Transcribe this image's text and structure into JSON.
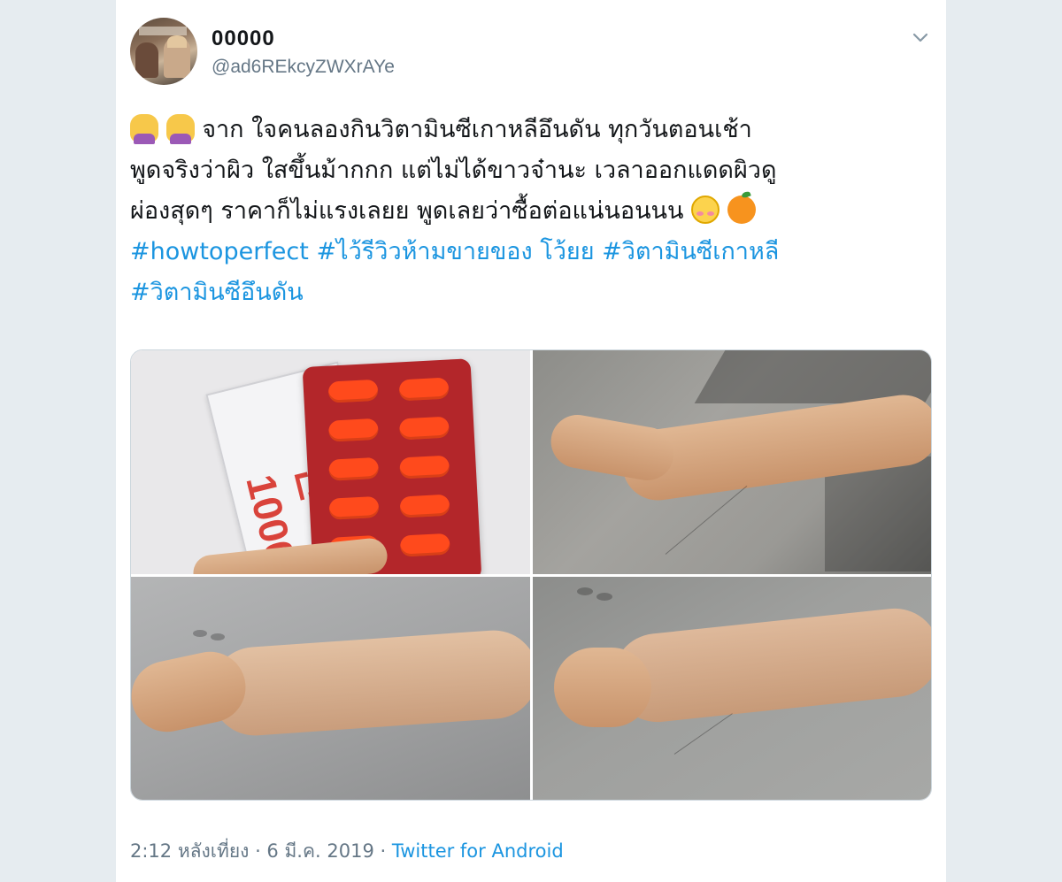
{
  "author": {
    "display_name": "00000",
    "handle": "@ad6REkcyZWXrAYe"
  },
  "tweet": {
    "lines": [
      "จาก ใจคนลองกินวิตามินซีเกาหลีอึนดัน ทุกวันตอนเช้า",
      "พูดจริงว่าผิว ใสขึ้นม้ากกก แต่ไม่ได้ขาวจ๋านะ เวลาออกแดดผิวดู",
      "ผ่องสุดๆ ราคาก็ไม่แรงเลยย  พูดเลยว่าซื้อต่อแน่นอนนน"
    ],
    "hashtags_line1": [
      "#howtoperfect",
      "#ไว้รีวิวห้ามขายของ โว้ยย",
      "#วิตามินซีเกาหลี"
    ],
    "hashtags_line2": [
      "#วิตามินซีอึนดัน"
    ],
    "emojis_start": [
      "woman-raising-hand-icon",
      "woman-raising-hand-icon"
    ],
    "emojis_end": [
      "smiling-face-blush-icon",
      "tangerine-icon"
    ]
  },
  "media": {
    "photos": [
      {
        "alt": "photo-pills",
        "package_text": "비타민 1000"
      },
      {
        "alt": "photo-arm-1"
      },
      {
        "alt": "photo-arm-2"
      },
      {
        "alt": "photo-arm-3"
      }
    ]
  },
  "meta": {
    "time": "2:12 หลังเที่ยง",
    "separator": " · ",
    "date": "6 มี.ค. 2019",
    "source": "Twitter for Android"
  },
  "colors": {
    "link": "#1b95e0",
    "secondary_text": "#657786",
    "background": "#e6ecf0",
    "pill": "#ff4a1c",
    "blister": "#b3262a"
  }
}
